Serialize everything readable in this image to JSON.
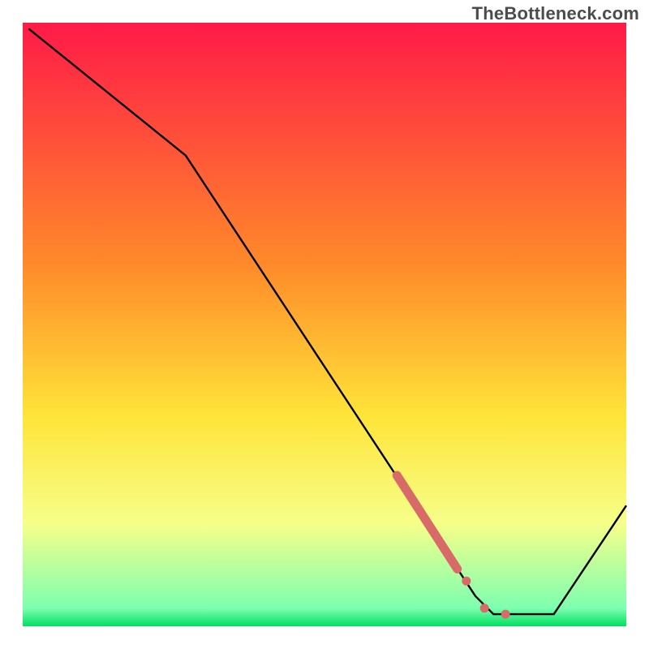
{
  "watermark": "TheBottleneck.com",
  "colors": {
    "grad_top": "#ff1a48",
    "grad_mid1": "#ff8a2a",
    "grad_mid2": "#ffe438",
    "grad_low": "#f6ff8a",
    "grad_bottom": "#00e060",
    "line": "#000000",
    "marker": "#d86a68"
  },
  "chart_data": {
    "type": "line",
    "title": "",
    "xlabel": "",
    "ylabel": "",
    "xlim": [
      0,
      100
    ],
    "ylim": [
      0,
      100
    ],
    "grid": false,
    "series": [
      {
        "name": "bottleneck-curve",
        "x": [
          1,
          27,
          75,
          78,
          88,
          100
        ],
        "y": [
          99,
          78,
          5,
          2,
          2,
          20
        ]
      }
    ],
    "markers": {
      "name": "highlighted-range",
      "segment_start": {
        "x": 62,
        "y": 25
      },
      "segment_end": {
        "x": 72,
        "y": 9.5
      },
      "dots": [
        {
          "x": 73.5,
          "y": 7.5
        },
        {
          "x": 76.5,
          "y": 3
        },
        {
          "x": 80,
          "y": 2
        }
      ]
    },
    "background_gradient_stops": [
      {
        "offset": 0.0,
        "color": "#ff1a48"
      },
      {
        "offset": 0.4,
        "color": "#ff8a2a"
      },
      {
        "offset": 0.65,
        "color": "#ffe438"
      },
      {
        "offset": 0.83,
        "color": "#f6ff8a"
      },
      {
        "offset": 0.97,
        "color": "#7dffb0"
      },
      {
        "offset": 1.0,
        "color": "#00e060"
      }
    ]
  }
}
